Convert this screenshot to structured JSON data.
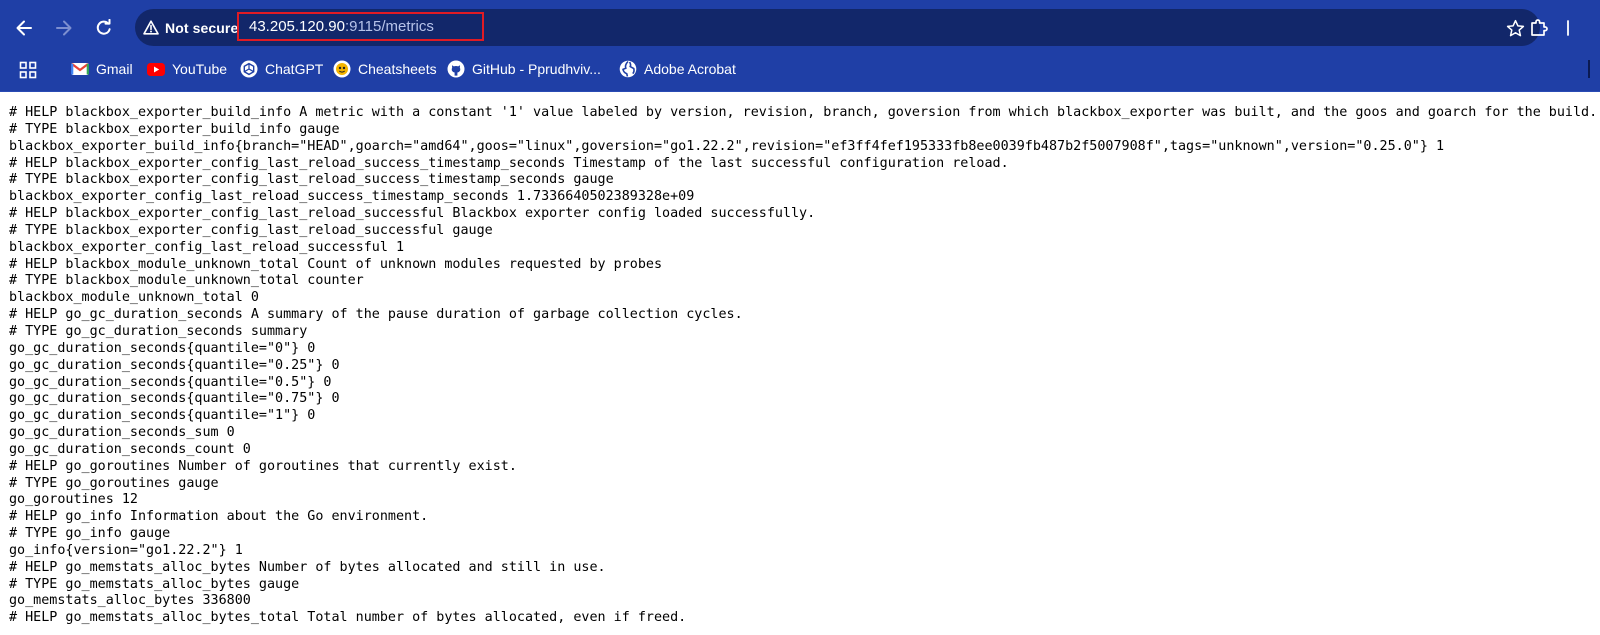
{
  "browser": {
    "security_label": "Not secure",
    "url_host": "43.205.120.90",
    "url_rest": ":9115/metrics",
    "icons": {
      "back": "arrow-left-icon",
      "forward": "arrow-right-icon",
      "reload": "reload-icon",
      "security": "warning-triangle-icon",
      "bookmark": "star-icon",
      "extensions": "puzzle-icon"
    }
  },
  "bookmarks": [
    {
      "label": "Gmail",
      "icon": "gmail-icon"
    },
    {
      "label": "YouTube",
      "icon": "youtube-icon"
    },
    {
      "label": "ChatGPT",
      "icon": "chatgpt-icon"
    },
    {
      "label": "Cheatsheets",
      "icon": "cheatsheets-icon"
    },
    {
      "label": "GitHub - Pprudhviv...",
      "icon": "github-icon"
    },
    {
      "label": "Adobe Acrobat",
      "icon": "globe-icon"
    }
  ],
  "metrics": [
    "# HELP blackbox_exporter_build_info A metric with a constant '1' value labeled by version, revision, branch, goversion from which blackbox_exporter was built, and the goos and goarch for the build.",
    "# TYPE blackbox_exporter_build_info gauge",
    "blackbox_exporter_build_info{branch=\"HEAD\",goarch=\"amd64\",goos=\"linux\",goversion=\"go1.22.2\",revision=\"ef3ff4fef195333fb8ee0039fb487b2f5007908f\",tags=\"unknown\",version=\"0.25.0\"} 1",
    "# HELP blackbox_exporter_config_last_reload_success_timestamp_seconds Timestamp of the last successful configuration reload.",
    "# TYPE blackbox_exporter_config_last_reload_success_timestamp_seconds gauge",
    "blackbox_exporter_config_last_reload_success_timestamp_seconds 1.7336640502389328e+09",
    "# HELP blackbox_exporter_config_last_reload_successful Blackbox exporter config loaded successfully.",
    "# TYPE blackbox_exporter_config_last_reload_successful gauge",
    "blackbox_exporter_config_last_reload_successful 1",
    "# HELP blackbox_module_unknown_total Count of unknown modules requested by probes",
    "# TYPE blackbox_module_unknown_total counter",
    "blackbox_module_unknown_total 0",
    "# HELP go_gc_duration_seconds A summary of the pause duration of garbage collection cycles.",
    "# TYPE go_gc_duration_seconds summary",
    "go_gc_duration_seconds{quantile=\"0\"} 0",
    "go_gc_duration_seconds{quantile=\"0.25\"} 0",
    "go_gc_duration_seconds{quantile=\"0.5\"} 0",
    "go_gc_duration_seconds{quantile=\"0.75\"} 0",
    "go_gc_duration_seconds{quantile=\"1\"} 0",
    "go_gc_duration_seconds_sum 0",
    "go_gc_duration_seconds_count 0",
    "# HELP go_goroutines Number of goroutines that currently exist.",
    "# TYPE go_goroutines gauge",
    "go_goroutines 12",
    "# HELP go_info Information about the Go environment.",
    "# TYPE go_info gauge",
    "go_info{version=\"go1.22.2\"} 1",
    "# HELP go_memstats_alloc_bytes Number of bytes allocated and still in use.",
    "# TYPE go_memstats_alloc_bytes gauge",
    "go_memstats_alloc_bytes 336800",
    "# HELP go_memstats_alloc_bytes_total Total number of bytes allocated, even if freed."
  ]
}
